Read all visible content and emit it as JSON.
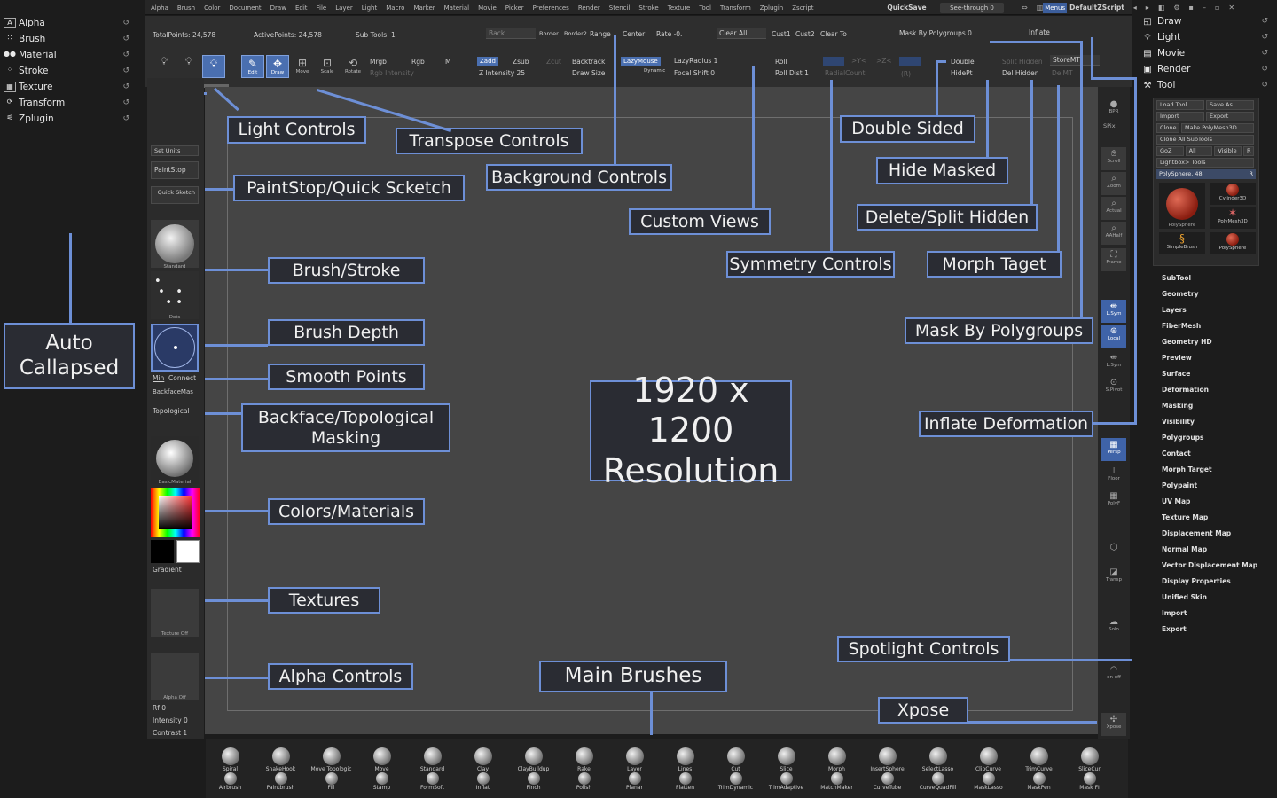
{
  "menubar": {
    "items": [
      "Alpha",
      "Brush",
      "Color",
      "Document",
      "Draw",
      "Edit",
      "File",
      "Layer",
      "Light",
      "Macro",
      "Marker",
      "Material",
      "Movie",
      "Picker",
      "Preferences",
      "Render",
      "Stencil",
      "Stroke",
      "Texture",
      "Tool",
      "Transform",
      "Zplugin",
      "Zscript"
    ],
    "quicksave": "QuickSave",
    "see_through": "See-through  0",
    "menus": "Menus",
    "script": "DefaultZScript"
  },
  "left_palettes": [
    "Alpha",
    "Brush",
    "Material",
    "Stroke",
    "Texture",
    "Transform",
    "Zplugin"
  ],
  "right_palettes": [
    "Draw",
    "Light",
    "Movie",
    "Render",
    "Tool"
  ],
  "tool_panel": {
    "rows": [
      [
        "Load Tool",
        "Save As"
      ],
      [
        "Import",
        "Export"
      ],
      [
        "Clone",
        "Make PolyMesh3D"
      ],
      [
        "Clone All SubTools"
      ],
      [
        "GoZ",
        "All",
        "Visible",
        "R"
      ],
      [
        "Lightbox> Tools"
      ]
    ],
    "slider": "PolySphere. 48",
    "slider_r": "R",
    "thumbs": [
      "PolySphere",
      "Cylinder3D",
      "PolyMesh3D",
      "SimpleBrush",
      "PolySphere"
    ]
  },
  "subpalettes": [
    "SubTool",
    "Geometry",
    "Layers",
    "FiberMesh",
    "Geometry HD",
    "Preview",
    "Surface",
    "Deformation",
    "Masking",
    "Visibility",
    "Polygroups",
    "Contact",
    "Morph Target",
    "Polypaint",
    "UV Map",
    "Texture Map",
    "Displacement Map",
    "Normal Map",
    "Vector Displacement Map",
    "Display Properties",
    "Unified Skin",
    "Import",
    "Export"
  ],
  "shelf": {
    "total_points": "TotalPoints: 24,578",
    "active_points": "ActivePoints: 24,578",
    "sub_tools": "Sub Tools: 1",
    "back": "Back",
    "border": "Border",
    "border2": "Border2",
    "range": "Range",
    "center": "Center",
    "rate": "Rate -0.",
    "clear_all": "Clear All",
    "cust1": "Cust1",
    "cust2": "Cust2",
    "clear_to": "Clear To",
    "mask_by_polygroups": "Mask By Polygroups 0",
    "inflate": "Inflate",
    "edit": "Edit",
    "draw": "Draw",
    "move": "Move",
    "scale": "Scale",
    "rotate": "Rotate",
    "mrgb": "Mrgb",
    "rgb": "Rgb",
    "m": "M",
    "rgb_intensity": "Rgb Intensity",
    "zadd": "Zadd",
    "zsub": "Zsub",
    "zcut": "Zcut",
    "z_intensity": "Z Intensity 25",
    "backtrack": "Backtrack",
    "draw_size": "Draw Size",
    "lazymouse": "LazyMouse",
    "dynamic": "Dynamic",
    "lazyradius": "LazyRadius 1",
    "focal_shift": "Focal Shift 0",
    "roll": "Roll",
    "roll_dist": "Roll Dist 1",
    "radialcount": "RadialCount",
    "r": "(R)",
    "double": "Double",
    "hidept": "HidePt",
    "split_hidden": "Split Hidden",
    "storemt": "StoreMT",
    "del_hidden": "Del Hidden",
    "delmt": "DelMT"
  },
  "left_tray": {
    "set_units": "Set Units",
    "paintstop": "PaintStop",
    "quick_sketch": "Quick Sketch",
    "standard": "Standard",
    "dots": "Dots",
    "min": "Min",
    "connect": "Connect",
    "backfacemask": "BackfaceMas",
    "topological": "Topological",
    "basicmaterial": "BasicMaterial",
    "gradient": "Gradient",
    "texture_off": "Texture Off",
    "alpha_off": "Alpha Off",
    "rf": "Rf 0",
    "intensity": "Intensity 0",
    "contrast": "Contrast 1"
  },
  "right_tray": [
    "BPR",
    "SPix",
    "Scroll",
    "Zoom",
    "Actual",
    "AAHalf",
    "Frame",
    "L.Sym",
    "Local",
    "L.Sym",
    "S.Pivot",
    "Persp",
    "Floor",
    "PolyF",
    "Transp",
    "Solo",
    "on off",
    "Xpose"
  ],
  "bottom_brushes_top": [
    "Spiral",
    "SnakeHook",
    "Move Topologic",
    "Move",
    "Standard",
    "Clay",
    "ClayBuildup",
    "Rake",
    "Layer",
    "Lines",
    "Cut",
    "Slice",
    "Morph",
    "InsertSphere",
    "SelectLasso",
    "ClipCurve",
    "TrimCurve",
    "SliceCur"
  ],
  "bottom_brushes_bottom": [
    "Airbrush",
    "Paintbrush",
    "Fill",
    "Stamp",
    "FormSoft",
    "Inflat",
    "Pinch",
    "Polish",
    "Planar",
    "Flatten",
    "TrimDynamic",
    "TrimAdaptive",
    "MatchMaker",
    "CurveTube",
    "CurveQuadFill",
    "MaskLasso",
    "MaskPen",
    "Mask FI"
  ],
  "callouts": {
    "light_controls": "Light Controls",
    "transpose_controls": "Transpose Controls",
    "background_controls": "Background Controls",
    "custom_views": "Custom Views",
    "paintstop_quick_sketch": "PaintStop/Quick Scketch",
    "brush_stroke": "Brush/Stroke",
    "brush_depth": "Brush Depth",
    "smooth_points": "Smooth Points",
    "backface_topological": "Backface/Topological Masking",
    "colors_materials": "Colors/Materials",
    "textures": "Textures",
    "alpha_controls": "Alpha Controls",
    "main_brushes": "Main Brushes",
    "auto_collapsed": "Auto Callapsed",
    "resolution": "1920 x 1200 Resolution",
    "double_sided": "Double Sided",
    "hide_masked": "Hide Masked",
    "delete_split_hidden": "Delete/Split Hidden",
    "symmetry_controls": "Symmetry Controls",
    "morph_target": "Morph Taget",
    "mask_by_polygroups": "Mask By Polygroups",
    "inflate_deformation": "Inflate Deformation",
    "spotlight_controls": "Spotlight Controls",
    "xpose": "Xpose"
  },
  "colors": {
    "accent": "#6d8fd6",
    "canvas": "#454545",
    "callout_bg": "#2a2c33"
  }
}
